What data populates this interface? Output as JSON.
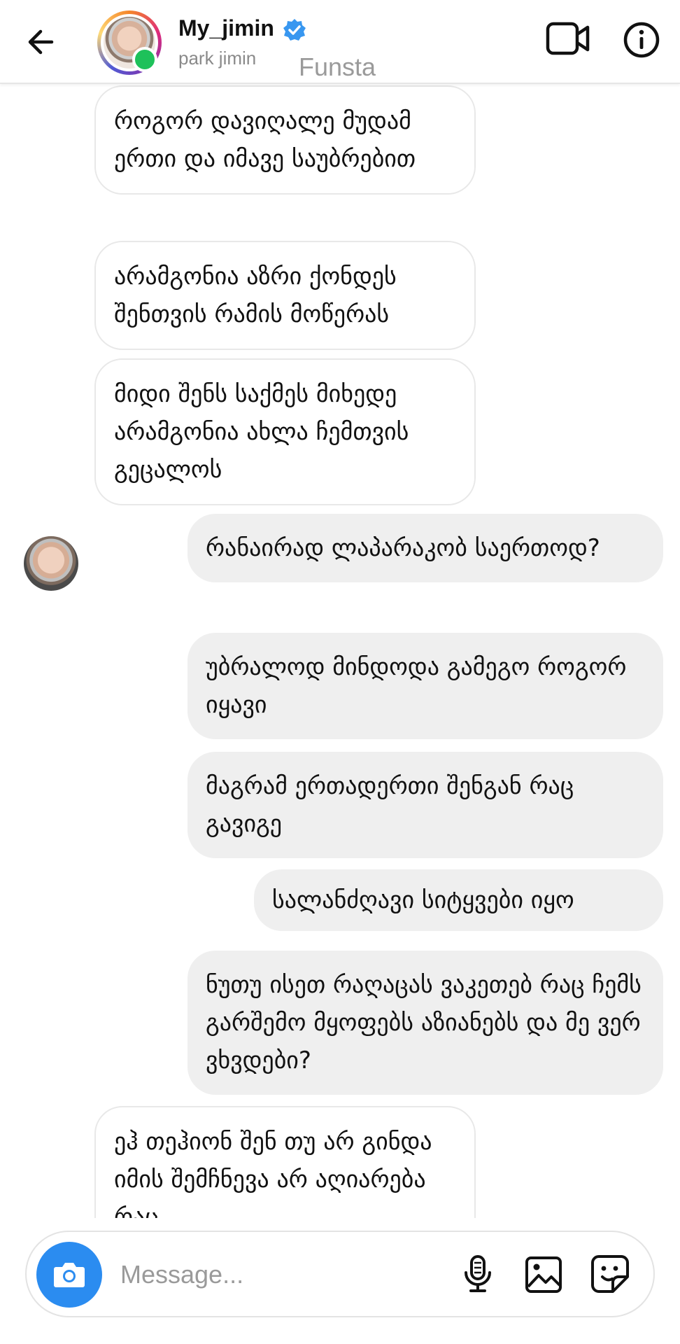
{
  "header": {
    "username": "My_jimin",
    "subtitle": "park jimin",
    "overlay_text": "Funsta"
  },
  "messages": [
    {
      "direction": "in",
      "text": "როგორ დავიღალე მუდამ ერთი და იმავე საუბრებით"
    },
    {
      "direction": "in",
      "text": "არამგონია აზრი ქონდეს შენთვის რამის მოწერას"
    },
    {
      "direction": "in",
      "text": "მიდი შენს საქმეს მიხედე არამგონია ახლა ჩემთვის გეცალოს"
    },
    {
      "direction": "out",
      "text": "რანაირად ლაპარაკობ საერთოდ?"
    },
    {
      "direction": "out",
      "text": "უბრალოდ მინდოდა გამეგო როგორ იყავი"
    },
    {
      "direction": "out",
      "text": "მაგრამ ერთადერთი შენგან რაც გავიგე"
    },
    {
      "direction": "out",
      "text": "სალანძღავი სიტყვები იყო"
    },
    {
      "direction": "out",
      "text": "ნუთუ ისეთ რაღაცას ვაკეთებ რაც ჩემს გარშემო მყოფებს აზიანებს და მე ვერ ვხვდები?"
    },
    {
      "direction": "in",
      "text": "ეჰ თეჰიონ შენ თუ არ გინდა იმის შემჩნევა არ აღიარება რაც"
    }
  ],
  "composer": {
    "placeholder": "Message..."
  },
  "colors": {
    "accent_blue": "#2b8cf0",
    "online_green": "#1ec15a",
    "outgoing_bubble": "#efefef",
    "verified_blue": "#3897f0"
  },
  "icons": [
    "back-arrow-icon",
    "verified-badge-icon",
    "video-call-icon",
    "info-icon",
    "camera-icon",
    "microphone-icon",
    "gallery-icon",
    "sticker-icon"
  ]
}
